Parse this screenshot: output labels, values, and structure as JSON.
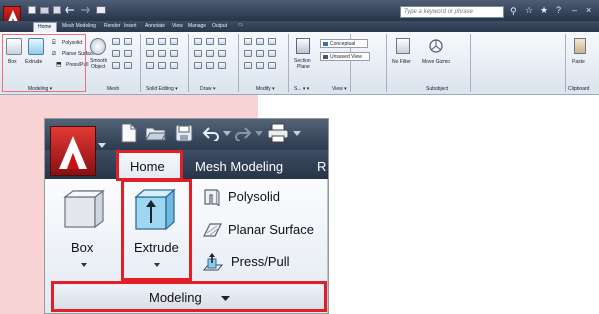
{
  "mini": {
    "tabs": [
      "Home",
      "Mesh Modeling",
      "Render",
      "Insert",
      "Annotate",
      "View",
      "Manage",
      "Output"
    ],
    "search_placeholder": "Type a keyword or phrase",
    "btn": {
      "box": "Box",
      "extrude": "Extrude",
      "polysolid": "Polysolid",
      "planar": "Planar Surface",
      "presspull": "Press/Pull",
      "smooth": "Smooth",
      "object": "Object",
      "section": "Section",
      "plane": "Plane",
      "conceptual": "Conceptual",
      "unsaved": "Unsaved View",
      "nofilter": "No Filter",
      "movegizmo": "Move Gizmo",
      "paste": "Paste"
    },
    "panels": {
      "modeling": "Modeling ▾",
      "mesh": "Mesh",
      "solid_editing": "Solid Editing ▾",
      "draw": "Draw ▾",
      "modify": "Modify ▾",
      "section": "S... ▾ ▾",
      "view": "View ▾",
      "subobject": "Subobject",
      "clipboard": "Clipboard"
    }
  },
  "zoom": {
    "tabs": {
      "home": "Home",
      "mesh": "Mesh Modeling",
      "partial": "R"
    },
    "box": "Box",
    "extrude": "Extrude",
    "polysolid": "Polysolid",
    "planar": "Planar Surface",
    "presspull": "Press/Pull",
    "panel": "Modeling"
  },
  "colors": {
    "accent": "#e21f24",
    "ribbon_dark": "#3e4d63",
    "ribbon_light": "#dfe7f1"
  }
}
